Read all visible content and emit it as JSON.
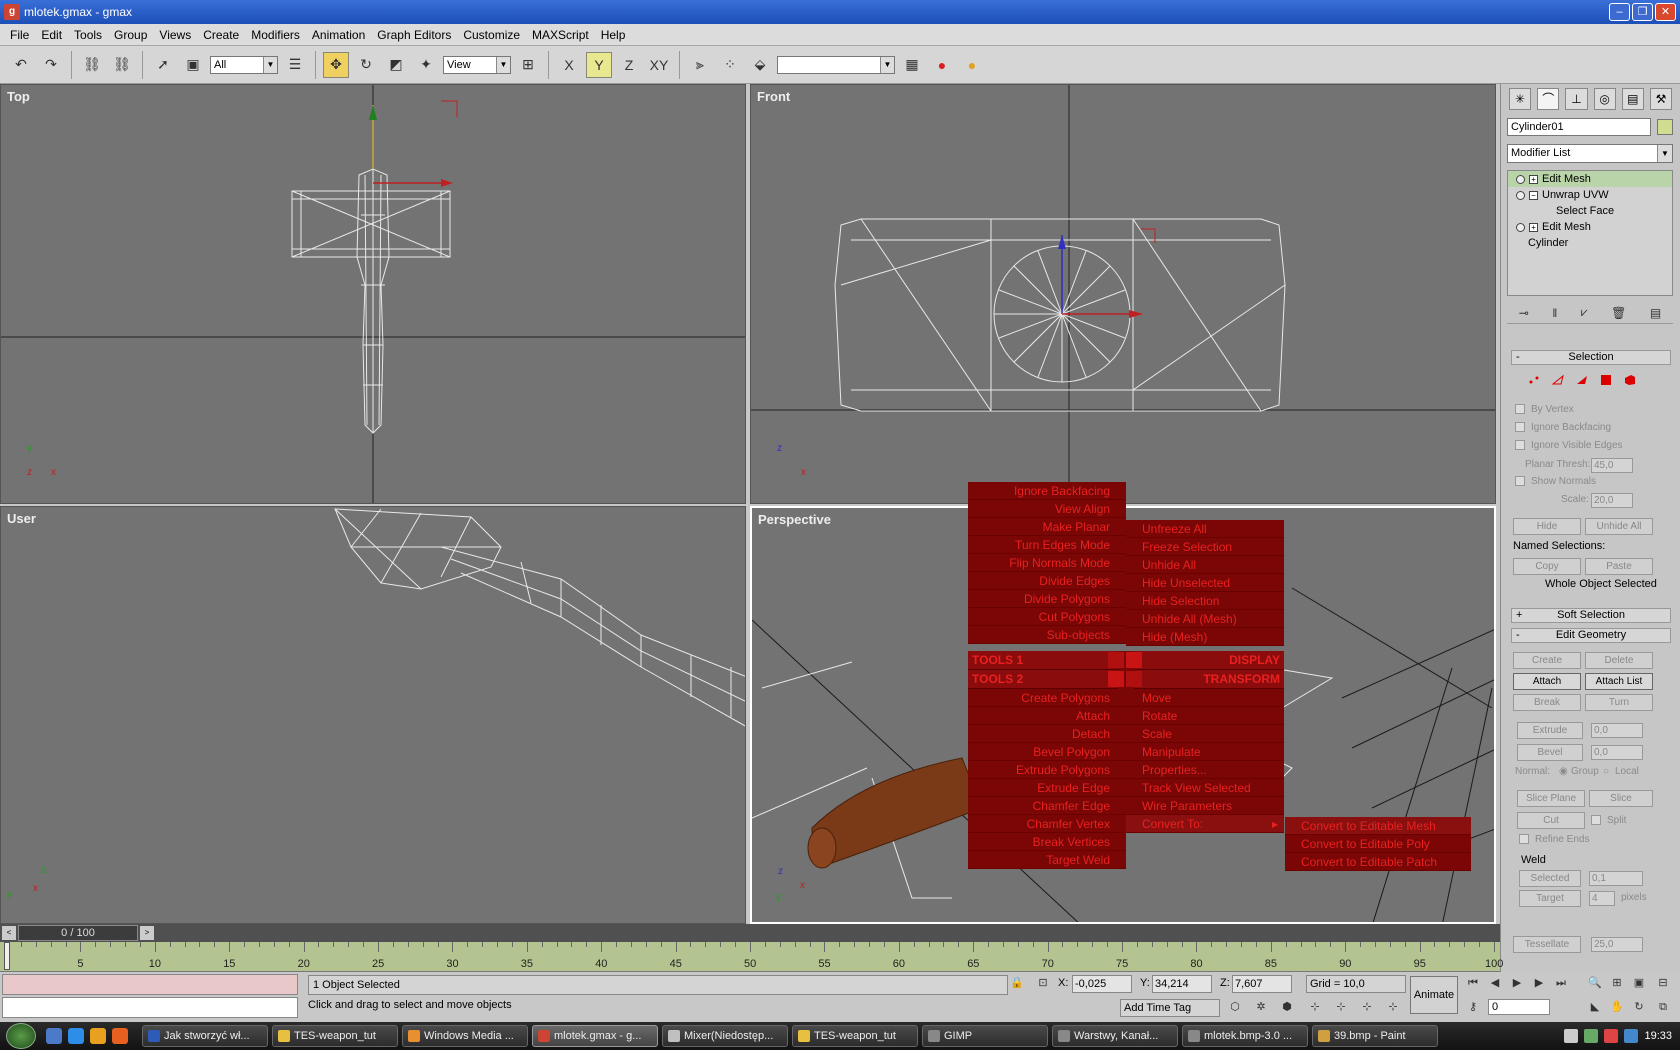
{
  "window": {
    "title": "mlotek.gmax - gmax",
    "buttons": [
      "–",
      "❐",
      "✕"
    ]
  },
  "menu": [
    "File",
    "Edit",
    "Tools",
    "Group",
    "Views",
    "Create",
    "Modifiers",
    "Animation",
    "Graph Editors",
    "Customize",
    "MAXScript",
    "Help"
  ],
  "toolbar": {
    "selection_filter": "All",
    "ref_coord": "View",
    "named_sel": "",
    "axis_labels": [
      "X",
      "Y",
      "Z",
      "XY"
    ]
  },
  "viewports": {
    "top": "Top",
    "front": "Front",
    "user": "User",
    "perspective": "Perspective"
  },
  "quad_menu": {
    "tools1_items": [
      "Ignore Backfacing",
      "View Align",
      "Make Planar",
      "Turn Edges Mode",
      "Flip Normals Mode",
      "Divide Edges",
      "Divide Polygons",
      "Cut Polygons",
      "Sub-objects"
    ],
    "display_items": [
      "Unfreeze All",
      "Freeze Selection",
      "Unhide All",
      "Hide Unselected",
      "Hide Selection",
      "Unhide All (Mesh)",
      "Hide (Mesh)"
    ],
    "tools1_header": "TOOLS 1",
    "tools2_header": "TOOLS 2",
    "display_header": "DISPLAY",
    "transform_header": "TRANSFORM",
    "tools2_items": [
      "Create Polygons",
      "Attach",
      "Detach",
      "Bevel Polygon",
      "Extrude Polygons",
      "Extrude Edge",
      "Chamfer Edge",
      "Chamfer Vertex",
      "Break Vertices",
      "Target Weld"
    ],
    "transform_items": [
      "Move",
      "Rotate",
      "Scale",
      "Manipulate",
      "Properties...",
      "Track View Selected",
      "Wire Parameters",
      "Convert To:"
    ],
    "convert_items": [
      "Convert to Editable Mesh",
      "Convert to Editable Poly",
      "Convert to Editable Patch"
    ],
    "submenu_arrow": "▸"
  },
  "command_panel": {
    "object_name": "Cylinder01",
    "modifier_list": "Modifier List",
    "swatch_color": "#d0dc90",
    "stack": [
      {
        "label": "Edit Mesh",
        "selected": true
      },
      {
        "label": "Unwrap UVW",
        "selected": false
      },
      {
        "label": "Select Face",
        "selected": false
      },
      {
        "label": "Edit Mesh",
        "selected": false
      },
      {
        "label": "Cylinder",
        "selected": false
      }
    ],
    "selection_rollout": "Selection",
    "selection_sign": "-",
    "by_vertex": "By Vertex",
    "ignore_backfacing": "Ignore Backfacing",
    "ignore_visible_edges": "Ignore Visible Edges",
    "planar_thresh_label": "Planar Thresh:",
    "planar_thresh": "45,0",
    "show_normals": "Show Normals",
    "scale_label": "Scale:",
    "scale": "20,0",
    "hide": "Hide",
    "unhide_all": "Unhide All",
    "named_selections": "Named Selections:",
    "copy": "Copy",
    "paste": "Paste",
    "whole_object": "Whole Object Selected",
    "soft_selection": "Soft Selection",
    "soft_sign": "+",
    "edit_geometry": "Edit Geometry",
    "edit_sign": "-",
    "create": "Create",
    "delete": "Delete",
    "attach": "Attach",
    "attach_list": "Attach List",
    "break": "Break",
    "turn": "Turn",
    "extrude": "Extrude",
    "extrude_val": "0,0",
    "bevel": "Bevel",
    "bevel_val": "0,0",
    "normal_label": "Normal:",
    "group": "Group",
    "local": "Local",
    "slice_plane": "Slice Plane",
    "slice": "Slice",
    "cut": "Cut",
    "split": "Split",
    "refine_ends": "Refine Ends",
    "weld": "Weld",
    "selected": "Selected",
    "selected_val": "0,1",
    "target": "Target",
    "target_val": "4",
    "pixels": "pixels",
    "tessellate": "Tessellate",
    "tessellate_val": "25,0"
  },
  "timeline": {
    "frame": "0 / 100",
    "arrow_left": "<",
    "arrow_right": ">",
    "ticks": [
      "5",
      "10",
      "15",
      "20",
      "25",
      "30",
      "35",
      "40",
      "45",
      "50",
      "55",
      "60",
      "65",
      "70",
      "75",
      "80",
      "85",
      "90",
      "95",
      "100"
    ]
  },
  "status": {
    "objects_selected": "1 Object Selected",
    "prompt": "Click and drag to select and move objects",
    "x_label": "X:",
    "x": "-0,025",
    "y_label": "Y:",
    "y": "34,214",
    "z_label": "Z:",
    "z": "7,607",
    "grid": "Grid = 10,0",
    "add_time_tag": "Add Time Tag",
    "animate": "Animate",
    "current_frame": "0"
  },
  "taskbar": {
    "buttons": [
      "Jak stworzyć wł...",
      "TES-weapon_tut",
      "Windows Media ...",
      "mlotek.gmax - g...",
      "Mixer(Niedostęp...",
      "TES-weapon_tut",
      "GIMP",
      "Warstwy, Kanał...",
      "mlotek.bmp-3.0 ...",
      "39.bmp - Paint"
    ],
    "active_index": 3,
    "clock": "19:33"
  },
  "colors": {
    "quad_bg": "#7a0606",
    "quad_text": "#ea2020",
    "viewport_bg": "#737373"
  }
}
